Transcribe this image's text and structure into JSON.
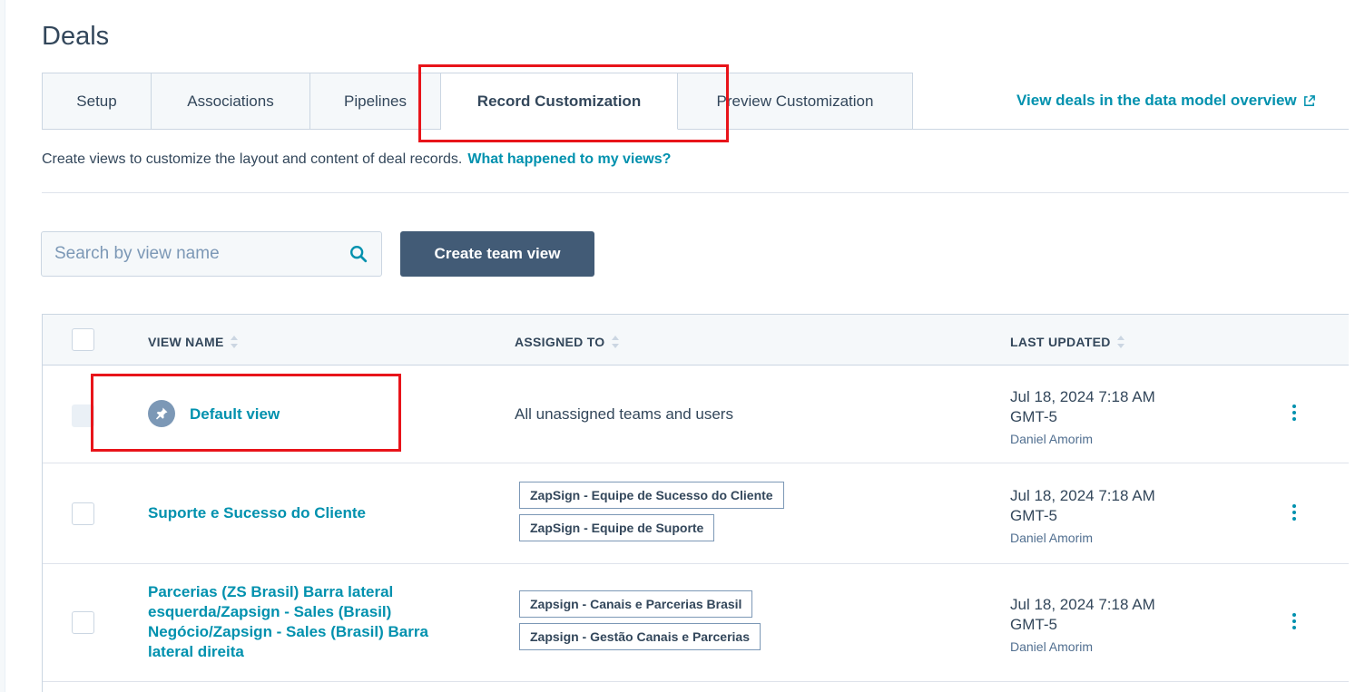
{
  "page": {
    "title": "Deals"
  },
  "tabs": [
    {
      "label": "Setup"
    },
    {
      "label": "Associations"
    },
    {
      "label": "Pipelines"
    },
    {
      "label": "Record Customization",
      "active": true
    },
    {
      "label": "Preview Customization"
    }
  ],
  "data_model_link": {
    "label": "View deals in the data model overview",
    "icon": "external-link-icon"
  },
  "description": {
    "text": "Create views to customize the layout and content of deal records.",
    "link": "What happened to my views?"
  },
  "search": {
    "placeholder": "Search by view name",
    "value": ""
  },
  "create_button": {
    "label": "Create team view"
  },
  "table": {
    "columns": [
      "VIEW NAME",
      "ASSIGNED TO",
      "LAST UPDATED"
    ],
    "rows": [
      {
        "view_name": "Default view",
        "is_default": true,
        "assigned_text": "All unassigned teams and users",
        "assigned_tags": [],
        "updated_line1": "Jul 18, 2024 7:18 AM",
        "updated_line2": "GMT-5",
        "updated_by": "Daniel Amorim"
      },
      {
        "view_name": "Suporte e Sucesso do Cliente",
        "is_default": false,
        "assigned_tags": [
          "ZapSign - Equipe de Sucesso do Cliente",
          "ZapSign - Equipe de Suporte"
        ],
        "updated_line1": "Jul 18, 2024 7:18 AM",
        "updated_line2": "GMT-5",
        "updated_by": "Daniel Amorim"
      },
      {
        "view_name_lines": [
          "Parcerias (ZS Brasil) Barra lateral",
          "esquerda/Zapsign - Sales (Brasil)",
          "Negócio/Zapsign - Sales (Brasil) Barra",
          "lateral direita"
        ],
        "is_default": false,
        "assigned_tags": [
          "Zapsign - Canais e Parcerias Brasil",
          "Zapsign - Gestão Canais e Parcerias"
        ],
        "updated_line1": "Jul 18, 2024 7:18 AM",
        "updated_line2": "GMT-5",
        "updated_by": "Daniel Amorim"
      }
    ]
  },
  "colors": {
    "accent_link": "#0091ae",
    "primary_button": "#425b76",
    "highlight_box": "#e8141a"
  }
}
